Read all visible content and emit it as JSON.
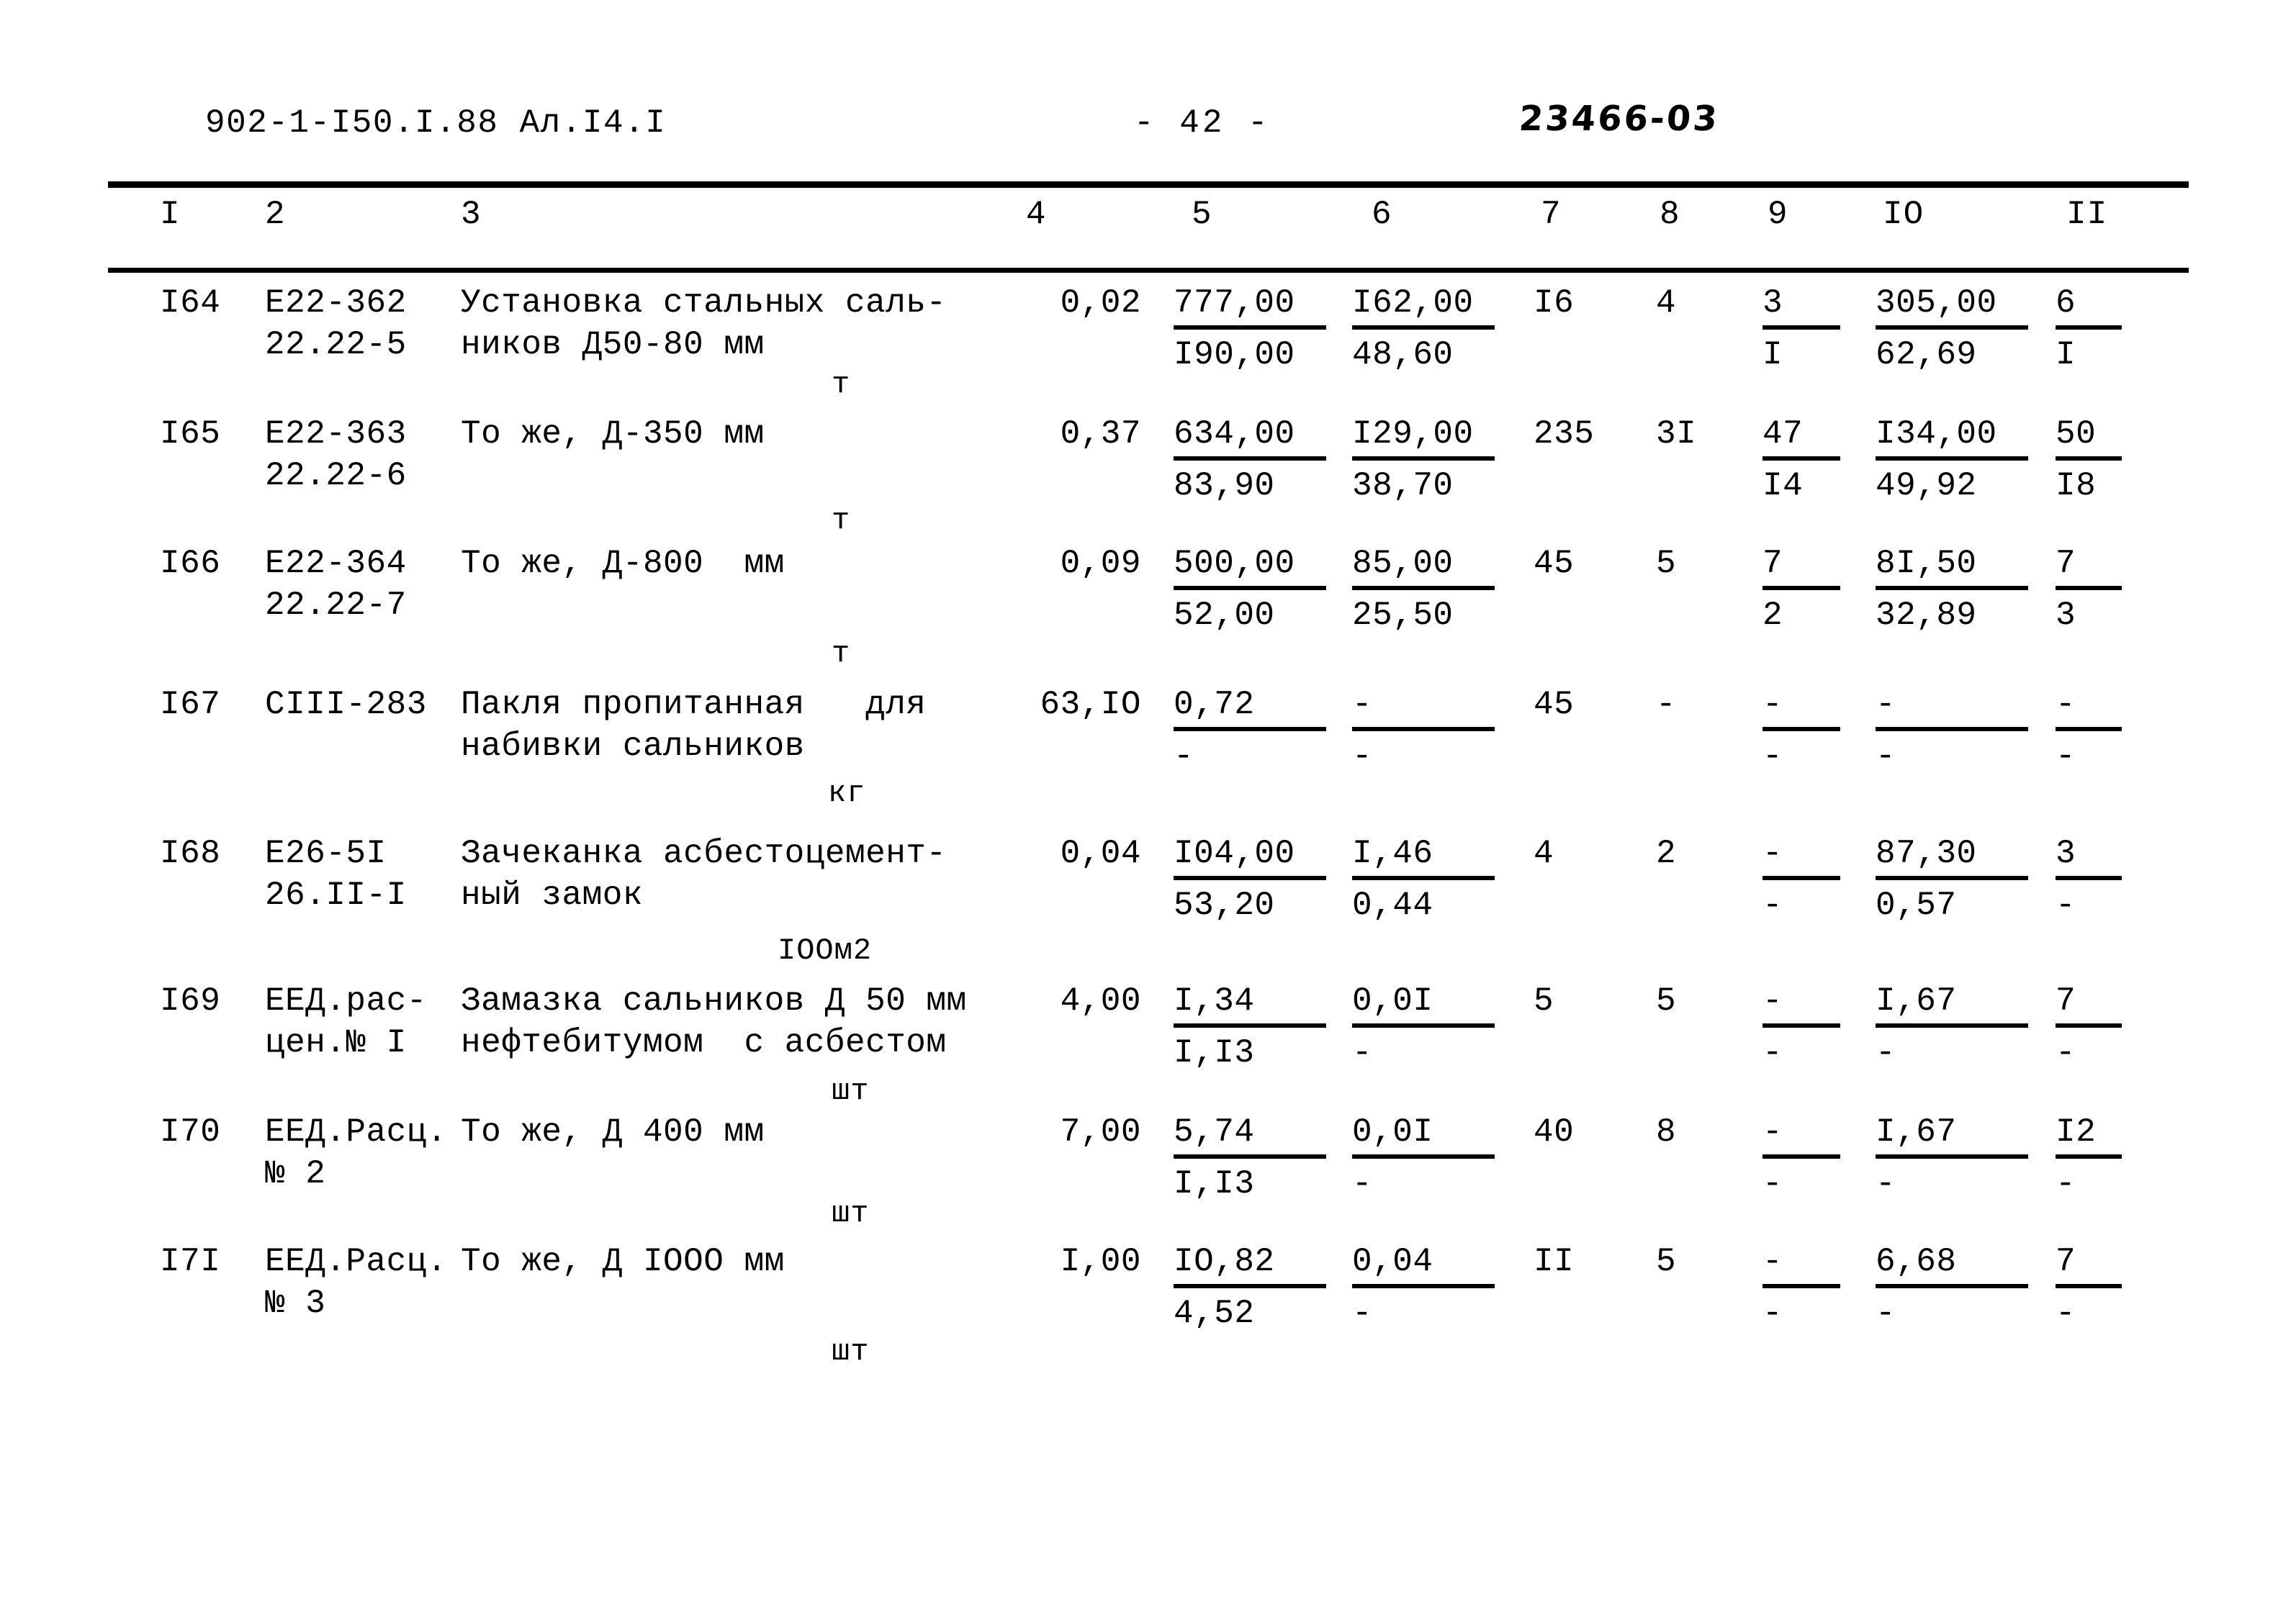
{
  "header": {
    "doc_code": "902-1-I50.I.88  Ал.I4.I",
    "page_number": "- 42  -",
    "stamp_code": "23466-03"
  },
  "table": {
    "column_headers": [
      "I",
      "2",
      "3",
      "4",
      "5",
      "6",
      "7",
      "8",
      "9",
      "IO",
      "II"
    ],
    "rows": [
      {
        "num": "I64",
        "code_line1": "Е22-362",
        "code_line2": "22.22-5",
        "desc_line1": "Установка стальных саль-",
        "desc_line2": "ников Д50-80 мм",
        "unit": "т",
        "qty": "0,02",
        "c5_top": "777,00",
        "c5_bot": "I90,00",
        "c6_top": "I62,00",
        "c6_bot": "48,60",
        "c7": "I6",
        "c8": "4",
        "c9_top": "3",
        "c9_bot": "I",
        "c10_top": "305,00",
        "c10_bot": "62,69",
        "c11_top": "6",
        "c11_bot": "I"
      },
      {
        "num": "I65",
        "code_line1": "Е22-363",
        "code_line2": "22.22-6",
        "desc_line1": "То же, Д-350 мм",
        "desc_line2": "",
        "unit": "т",
        "qty": "0,37",
        "c5_top": "634,00",
        "c5_bot": "83,90",
        "c6_top": "I29,00",
        "c6_bot": "38,70",
        "c7": "235",
        "c8": "3I",
        "c9_top": "47",
        "c9_bot": "I4",
        "c10_top": "I34,00",
        "c10_bot": "49,92",
        "c11_top": "50",
        "c11_bot": "I8"
      },
      {
        "num": "I66",
        "code_line1": "Е22-364",
        "code_line2": "22.22-7",
        "desc_line1": "То же, Д-800  мм",
        "desc_line2": "",
        "unit": "т",
        "qty": "0,09",
        "c5_top": "500,00",
        "c5_bot": "52,00",
        "c6_top": "85,00",
        "c6_bot": "25,50",
        "c7": "45",
        "c8": "5",
        "c9_top": "7",
        "c9_bot": "2",
        "c10_top": "8I,50",
        "c10_bot": "32,89",
        "c11_top": "7",
        "c11_bot": "3"
      },
      {
        "num": "I67",
        "code_line1": "СIII-283",
        "code_line2": "",
        "desc_line1": "Пакля пропитанная   для",
        "desc_line2": "набивки сальников",
        "unit": "кг",
        "qty": "63,IO",
        "c5_top": "0,72",
        "c5_bot": "-",
        "c6_top": "-",
        "c6_bot": "-",
        "c7": "45",
        "c8": "-",
        "c9_top": "-",
        "c9_bot": "-",
        "c10_top": "-",
        "c10_bot": "-",
        "c11_top": "-",
        "c11_bot": "-"
      },
      {
        "num": "I68",
        "code_line1": "Е26-5I",
        "code_line2": "26.II-I",
        "desc_line1": "Зачеканка асбестоцемент-",
        "desc_line2": "ный замок",
        "unit": "IOOм2",
        "qty": "0,04",
        "c5_top": "I04,00",
        "c5_bot": "53,20",
        "c6_top": "I,46",
        "c6_bot": "0,44",
        "c7": "4",
        "c8": "2",
        "c9_top": "-",
        "c9_bot": "-",
        "c10_top": "87,30",
        "c10_bot": "0,57",
        "c11_top": "3",
        "c11_bot": "-"
      },
      {
        "num": "I69",
        "code_line1": "ЕЕД.рас-",
        "code_line2": "цен.№ I",
        "desc_line1": "Замазка сальников Д 50 мм",
        "desc_line2": "нефтебитумом  с асбестом",
        "unit": "шт",
        "qty": "4,00",
        "c5_top": "I,34",
        "c5_bot": "I,I3",
        "c6_top": "0,0I",
        "c6_bot": "-",
        "c7": "5",
        "c8": "5",
        "c9_top": "-",
        "c9_bot": "-",
        "c10_top": "I,67",
        "c10_bot": "-",
        "c11_top": "7",
        "c11_bot": "-"
      },
      {
        "num": "I70",
        "code_line1": "ЕЕД.Расц.",
        "code_line2": "№ 2",
        "desc_line1": "То же, Д 400 мм",
        "desc_line2": "",
        "unit": "шт",
        "qty": "7,00",
        "c5_top": "5,74",
        "c5_bot": "I,I3",
        "c6_top": "0,0I",
        "c6_bot": "-",
        "c7": "40",
        "c8": "8",
        "c9_top": "-",
        "c9_bot": "-",
        "c10_top": "I,67",
        "c10_bot": "-",
        "c11_top": "I2",
        "c11_bot": "-"
      },
      {
        "num": "I7I",
        "code_line1": "ЕЕД.Расц.",
        "code_line2": "№ 3",
        "desc_line1": "То же, Д IOOO мм",
        "desc_line2": "",
        "unit": "шт",
        "qty": "I,00",
        "c5_top": "IO,82",
        "c5_bot": "4,52",
        "c6_top": "0,04",
        "c6_bot": "-",
        "c7": "II",
        "c8": "5",
        "c9_top": "-",
        "c9_bot": "-",
        "c10_top": "6,68",
        "c10_bot": "-",
        "c11_top": "7",
        "c11_bot": "-"
      }
    ]
  }
}
